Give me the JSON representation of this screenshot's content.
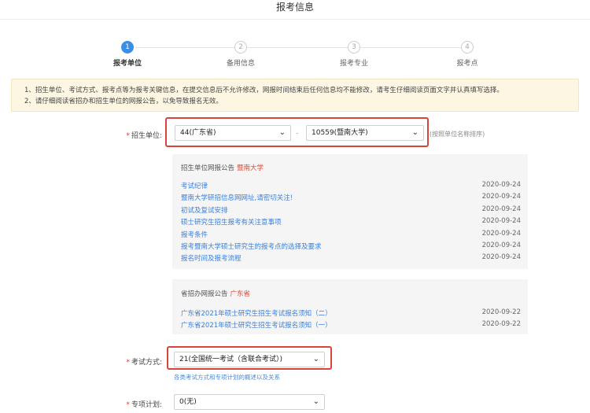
{
  "page": {
    "title": "报考信息"
  },
  "steps": [
    {
      "num": "1",
      "label": "报考单位"
    },
    {
      "num": "2",
      "label": "备用信息"
    },
    {
      "num": "3",
      "label": "报考专业"
    },
    {
      "num": "4",
      "label": "报考点"
    }
  ],
  "notice": [
    "1、招生单位、考试方式、报考点等为报考关键信息，在提交信息后不允许修改，网报时间结束后任何信息均不能修改，请考生仔细阅读页面文字并认真填写选择。",
    "2、请仔细阅读省招办和招生单位的网报公告，以免导致报名无效。"
  ],
  "form": {
    "unit": {
      "required_mark": "*",
      "label": "招生单位:",
      "province_value": "44(广东省)",
      "separator": "-",
      "school_value": "10559(暨南大学)",
      "hint": "(按照单位名称排序)"
    },
    "exam": {
      "required_mark": "*",
      "label": "考试方式:",
      "value": "21(全国统一考试（含联合考试）)",
      "hint": "各类考试方式和专项计划的概述以及关系"
    },
    "plan": {
      "required_mark": "*",
      "label": "专项计划:",
      "value": "0(无)"
    }
  },
  "school_notices": {
    "title": "招生单位网报公告",
    "tag": "暨南大学",
    "items": [
      {
        "title": "考试纪律",
        "date": "2020-09-24"
      },
      {
        "title": "暨南大学研招信息网网址,请密切关注!",
        "date": "2020-09-24"
      },
      {
        "title": "初试及复试安排",
        "date": "2020-09-24"
      },
      {
        "title": "硕士研究生招生报考有关注意事项",
        "date": "2020-09-24"
      },
      {
        "title": "报考条件",
        "date": "2020-09-24"
      },
      {
        "title": "报考暨南大学硕士研究生的报考点的选择及要求",
        "date": "2020-09-24"
      },
      {
        "title": "报名时间及报考流程",
        "date": "2020-09-24"
      }
    ]
  },
  "province_notices": {
    "title": "省招办网报公告",
    "tag": "广东省",
    "items": [
      {
        "title": "广东省2021年硕士研究生招生考试报名须知（二）",
        "date": "2020-09-22"
      },
      {
        "title": "广东省2021年硕士研究生招生考试报名须知（一）",
        "date": "2020-09-22"
      }
    ]
  },
  "colors": {
    "accent": "#3a8ee6",
    "highlight": "#d8433a",
    "link": "#3a7fd9",
    "notice_bg": "#fdf6e3"
  },
  "icons": {
    "select_chevron": "chevron-down-icon"
  }
}
